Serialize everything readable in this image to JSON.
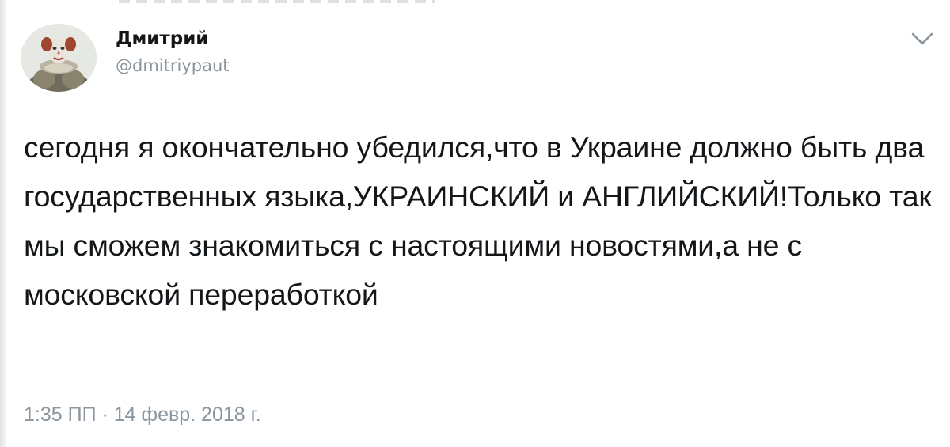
{
  "tweet": {
    "author": {
      "display_name": "Дмитрий",
      "handle": "@dmitriypaut"
    },
    "text": "сегодня я окончательно убедился,что в Украине должно быть два государственных языка,УКРАИНСКИЙ и АНГЛИЙСКИЙ!Только так мы сможем знакомиться с настоящими новостями,а не с московской переработкой",
    "timestamp": "1:35 ПП · 14 февр. 2018 г.",
    "menu_icon": "chevron-down-icon"
  }
}
